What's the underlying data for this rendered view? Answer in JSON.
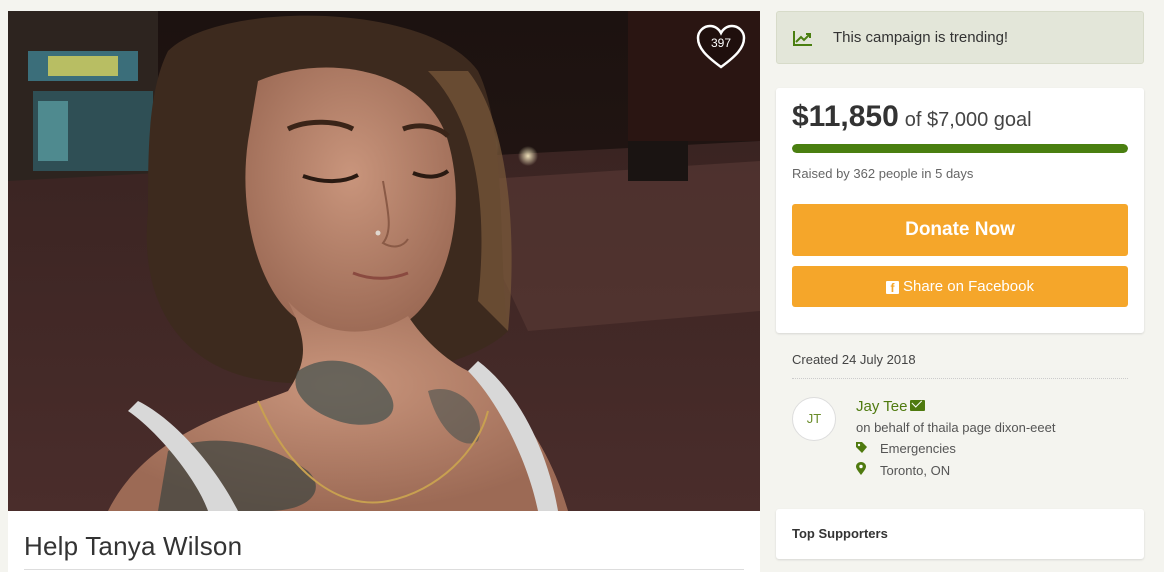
{
  "campaign": {
    "title": "Help Tanya Wilson",
    "like_count": "397"
  },
  "trending": {
    "text": "This campaign is trending!",
    "icon": "trending-chart-icon"
  },
  "fundraising": {
    "amount_raised": "$11,850",
    "goal_text": "of $7,000 goal",
    "progress_fraction": 1.0,
    "raised_by": "Raised by 362 people in 5 days"
  },
  "buttons": {
    "donate": "Donate Now",
    "share": "Share on Facebook"
  },
  "details": {
    "created": "Created 24 July 2018",
    "organizer_initials": "JT",
    "organizer_name": "Jay Tee",
    "on_behalf": "on behalf of thaila page dixon-eeet",
    "category": "Emergencies",
    "location": "Toronto, ON"
  },
  "supporters": {
    "heading": "Top Supporters"
  },
  "colors": {
    "accent_orange": "#f5a62a",
    "brand_green": "#4a7f10",
    "trend_bg": "#e3e6d9"
  }
}
